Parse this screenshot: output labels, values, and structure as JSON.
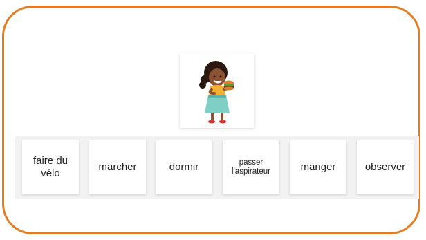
{
  "prompt": {
    "image_icon": "girl-eating-burger-illustration"
  },
  "choices": [
    {
      "label": "faire du\nvélo",
      "size": "normal"
    },
    {
      "label": "marcher",
      "size": "normal"
    },
    {
      "label": "dormir",
      "size": "normal"
    },
    {
      "label": "passer\nl'aspirateur",
      "size": "small"
    },
    {
      "label": "manger",
      "size": "normal"
    },
    {
      "label": "observer",
      "size": "normal"
    }
  ],
  "colors": {
    "frame_border": "#e27d22",
    "tray_background": "#f2f2f2",
    "card_background": "#ffffff"
  }
}
